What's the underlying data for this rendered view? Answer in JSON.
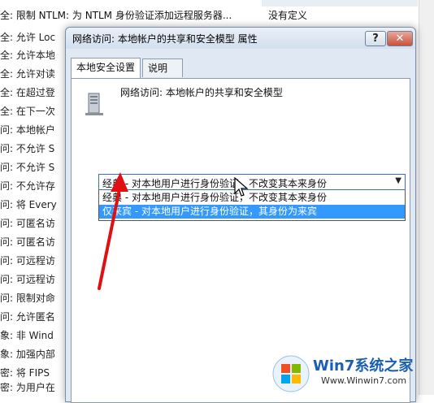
{
  "background": {
    "first_row": {
      "policy": "全: 限制 NTLM: 为 NTLM 身份验证添加远程服务器...",
      "value": "没有定义"
    },
    "rows": [
      "全: 允许 Loc",
      "全: 允许本地",
      "全: 允许对读",
      "全: 在超过登",
      "全: 在下一次",
      "问: 本地帐户",
      "问: 不允许 S",
      "问: 不允许 S",
      "问: 不允许存",
      "问: 将 Every",
      "问: 可匿名访",
      "问: 可匿名访",
      "问: 可远程访",
      "问: 可远程访",
      "问: 限制对命",
      "问: 允许匿名",
      "象: 非 Wind",
      "象: 加强内部",
      "密: 将 FIPS",
      "密: 为用户在"
    ]
  },
  "dialog": {
    "title": "网络访问: 本地帐户的共享和安全模型 属性",
    "help_label": "?",
    "close_label": "✕",
    "tabs": [
      {
        "label": "本地安全设置",
        "active": true
      },
      {
        "label": "说明",
        "active": false
      }
    ],
    "policy_name": "网络访问: 本地帐户的共享和安全模型",
    "combo": {
      "selected": "经典 - 对本地用户进行身份验证，不改变其本来身份",
      "options": [
        "经典 - 对本地用户进行身份验证，不改变其本来身份",
        "仅来宾 - 对本地用户进行身份验证，其身份为来宾"
      ],
      "highlighted_index": 1
    }
  },
  "watermark": {
    "brand": "Win7系统之家",
    "url": "Www.Winwin7.com"
  },
  "colors": {
    "highlight": "#3399ff",
    "arrow": "#e01010",
    "dialog_bg": "#dfe8f3"
  }
}
